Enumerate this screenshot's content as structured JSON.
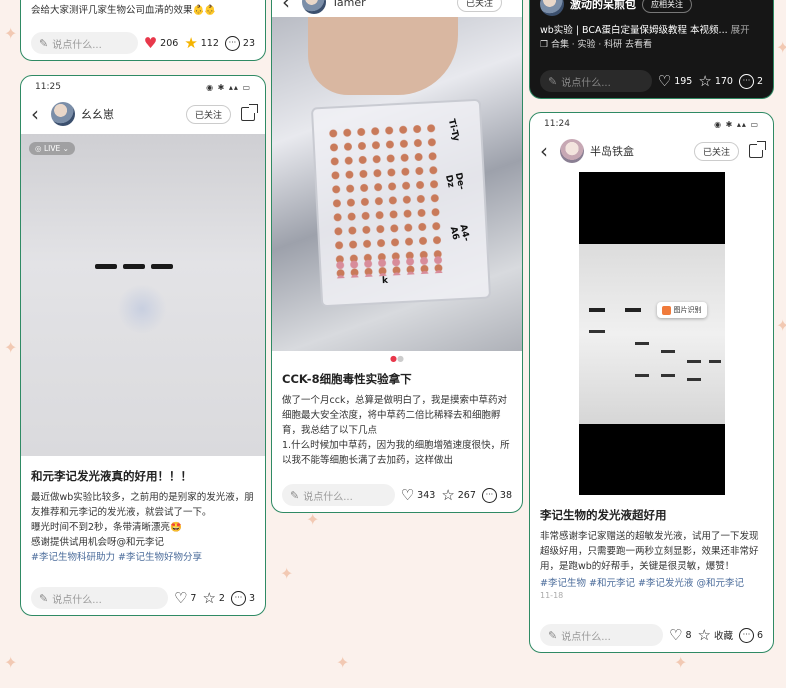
{
  "colors": {
    "card_border": "#2f8a64",
    "background": "#fbf1ec",
    "tag_blue": "#4a6b9a",
    "like_red": "#e8384b",
    "star_yellow": "#f5b400"
  },
  "comment_placeholder": "说点什么...",
  "top_left": {
    "text_line": "会给大家测评几家生物公司血清的效果👶👶",
    "likes": "206",
    "stars": "112",
    "comments": "23"
  },
  "top_middle": {
    "username": "Tamer",
    "follow": "已关注"
  },
  "top_right": {
    "username": "激动的呆煎包",
    "follow": "应相关注",
    "caption": "wb实验 | BCA蛋白定量保姆级教程 本视频...",
    "expand": "展开",
    "collection_line": "合集 · 实验 · 科研   去看看",
    "likes": "195",
    "stars": "170",
    "comments": "2"
  },
  "card1": {
    "time": "11:25",
    "username": "幺幺崽",
    "follow": "已关注",
    "live_badge": "LIVE",
    "title": "和元李记发光液真的好用！！！",
    "body": [
      "最近做wb实验比较多，之前用的是别家的发光液，朋友推荐和元李记的发光液，就尝试了一下。",
      "曝光时间不到2秒，条带清晰漂亮🤩",
      "感谢提供试用机会呀@和元李记"
    ],
    "tags": "#李记生物科研助力 #李记生物好物分享",
    "likes": "7",
    "stars": "2",
    "comments": "3"
  },
  "card2": {
    "plate_labels": [
      "Ti-Ty",
      "De-Dz",
      "A4-A6",
      "k"
    ],
    "title": "CCK-8细胞毒性实验拿下",
    "body": [
      "做了一个月cck，总算是做明白了，我是摸索中草药对细胞最大安全浓度，将中草药二倍比稀释去和细胞孵育，我总结了以下几点",
      "1.什么时候加中草药，因为我的细胞增殖速度很快，所以我不能等细胞长满了去加药，这样做出"
    ],
    "likes": "343",
    "stars": "267",
    "comments": "38"
  },
  "card3": {
    "time": "11:24",
    "username": "半岛铁盒",
    "follow": "已关注",
    "overlay_button": "图片识别",
    "title": "李记生物的发光液超好用",
    "body": [
      "非常感谢李记家赠送的超敏发光液，试用了一下发现超级好用，只需要跑一两秒立刻显影，效果还非常好用，是跑wb的好帮手，关键是很灵敏，爆赞！"
    ],
    "tags": "#李记生物 #和元李记 #李记发光液 @和元李记",
    "date": "11-18",
    "likes": "8",
    "stars": "收藏",
    "comments": "6"
  }
}
